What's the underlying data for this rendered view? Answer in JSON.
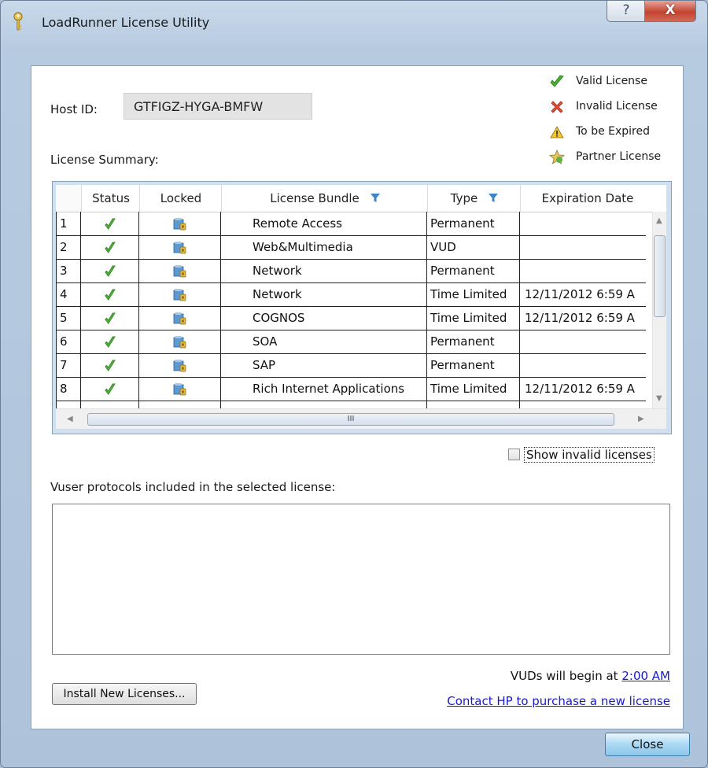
{
  "window": {
    "title": "LoadRunner License Utility",
    "help_glyph": "?",
    "close_glyph": "X"
  },
  "host": {
    "label": "Host ID:",
    "value": "GTFIGZ-HYGA-BMFW"
  },
  "summary_label": "License Summary:",
  "legend": [
    {
      "icon": "check-icon",
      "label": "Valid License"
    },
    {
      "icon": "x-icon",
      "label": "Invalid License"
    },
    {
      "icon": "warning-icon",
      "label": "To be Expired"
    },
    {
      "icon": "star-icon",
      "label": "Partner License"
    }
  ],
  "table": {
    "columns": [
      "Status",
      "Locked",
      "License Bundle",
      "Type",
      "Expiration Date"
    ],
    "rows": [
      {
        "n": "1",
        "bundle": "Remote Access",
        "type": "Permanent",
        "exp": ""
      },
      {
        "n": "2",
        "bundle": "Web&Multimedia",
        "type": "VUD",
        "exp": ""
      },
      {
        "n": "3",
        "bundle": "Network",
        "type": "Permanent",
        "exp": ""
      },
      {
        "n": "4",
        "bundle": "Network",
        "type": "Time Limited",
        "exp": "12/11/2012 6:59 A"
      },
      {
        "n": "5",
        "bundle": "COGNOS",
        "type": "Time Limited",
        "exp": "12/11/2012 6:59 A"
      },
      {
        "n": "6",
        "bundle": "SOA",
        "type": "Permanent",
        "exp": ""
      },
      {
        "n": "7",
        "bundle": "SAP",
        "type": "Permanent",
        "exp": ""
      },
      {
        "n": "8",
        "bundle": "Rich Internet Applications",
        "type": "Time Limited",
        "exp": "12/11/2012 6:59 A"
      }
    ],
    "hscroll_thumb_glyph": "III"
  },
  "show_invalid": {
    "label": "Show invalid licenses",
    "checked": false
  },
  "protocols_label": "Vuser protocols included in the selected license:",
  "install_button": "Install New Licenses...",
  "vuds": {
    "prefix": "VUDs will begin at",
    "time": "2:00 AM"
  },
  "contact_link": "Contact HP to purchase a new license",
  "close_button": "Close",
  "colors": {
    "accent": "#1a1acc",
    "valid": "#3fa62c",
    "invalid": "#d9432f"
  }
}
